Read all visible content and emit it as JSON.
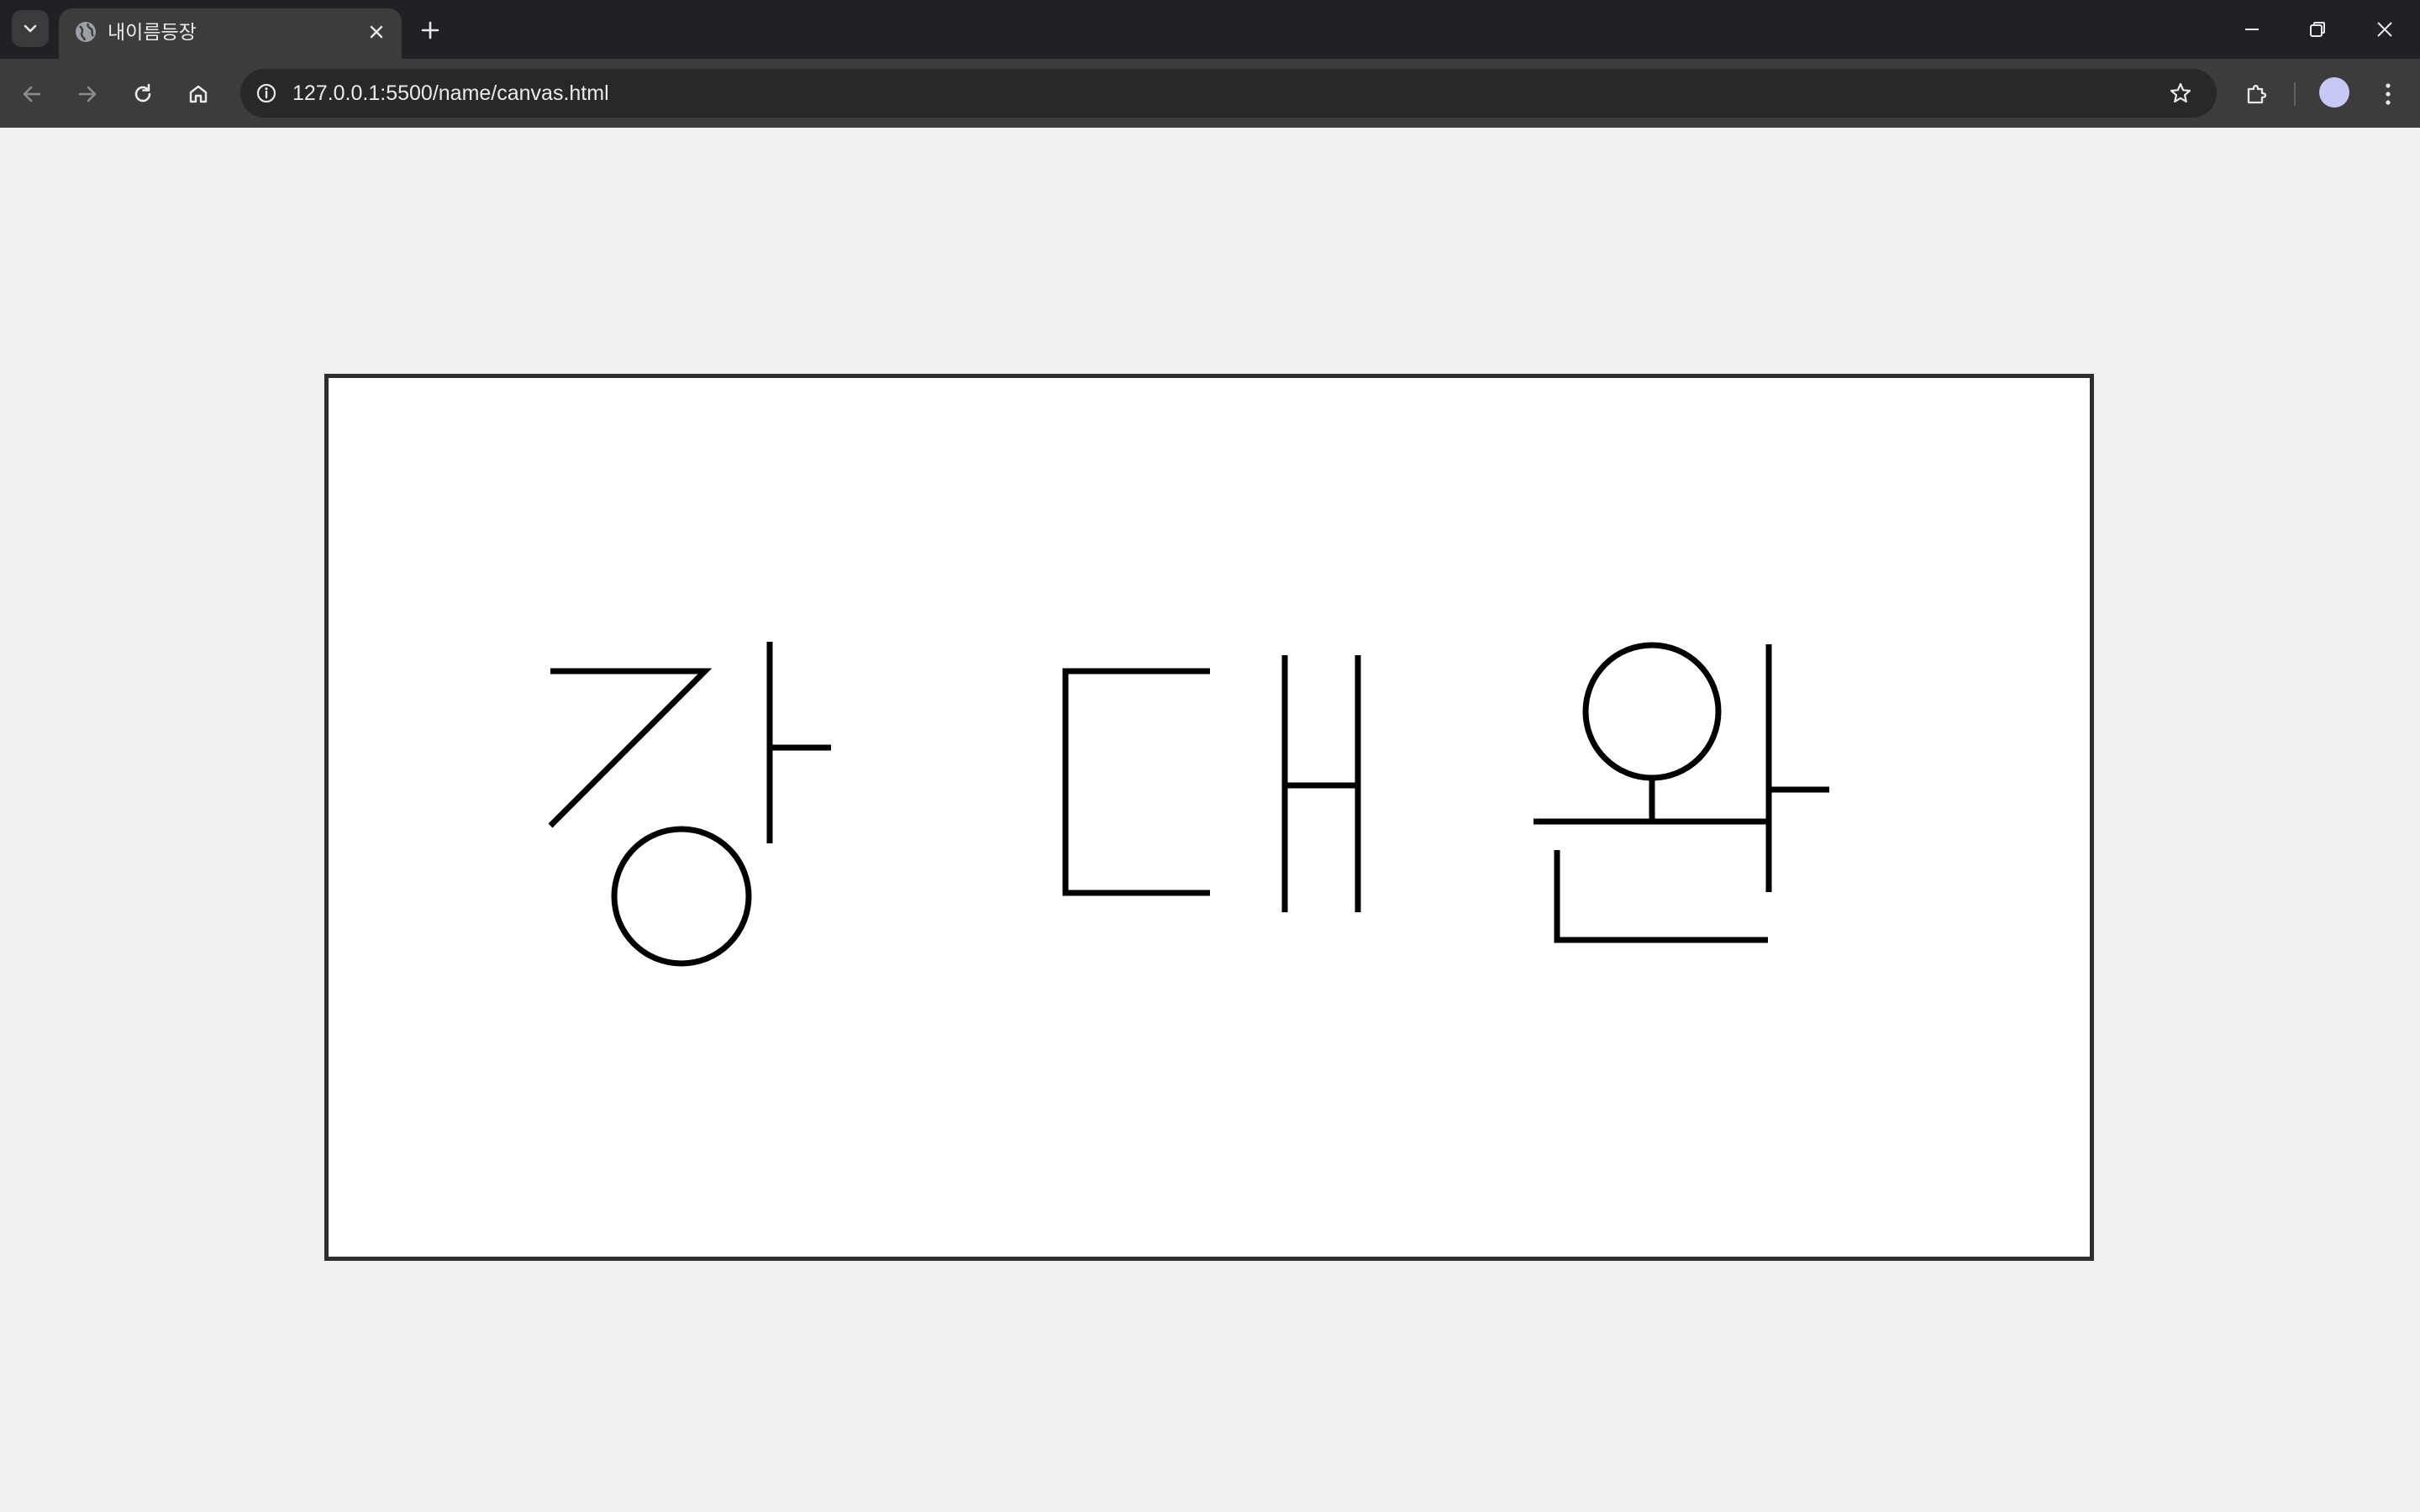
{
  "browser": {
    "tab": {
      "title": "내이름등장",
      "favicon": "globe-icon"
    },
    "address_bar": {
      "url": "127.0.0.1:5500/name/canvas.html",
      "security_icon": "info-icon"
    },
    "icons": {
      "tab_list": "chevron-down-icon",
      "new_tab": "plus-icon",
      "minimize": "minimize-icon",
      "restore": "restore-icon",
      "close": "close-icon",
      "back": "back-arrow-icon",
      "forward": "forward-arrow-icon",
      "reload": "reload-icon",
      "home": "home-icon",
      "bookmark": "star-icon",
      "extensions": "puzzle-icon",
      "profile": "avatar",
      "menu": "kebab-menu-icon"
    }
  },
  "canvas": {
    "drawing": "강 대 완",
    "stroke_color": "#000000",
    "background": "#ffffff",
    "border_color": "#2e2e2e"
  }
}
